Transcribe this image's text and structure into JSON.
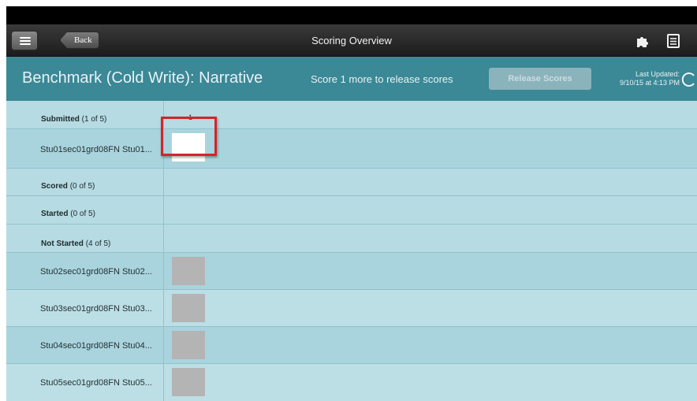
{
  "nav": {
    "back_label": "Back",
    "title": "Scoring Overview",
    "icons": [
      "menu-icon",
      "puzzle-piece-icon",
      "list-icon"
    ]
  },
  "header": {
    "title": "Benchmark (Cold Write): Narrative",
    "score_status": "Score  1  more to release scores",
    "release_button": "Release Scores",
    "last_updated_label": "Last Updated:",
    "last_updated_value": "9/10/15 at 4:13 PM",
    "refresh_icon": "refresh-icon"
  },
  "table": {
    "columns": [
      "1"
    ],
    "sections": [
      {
        "name": "Submitted",
        "count": "(1 of 5)",
        "students": [
          {
            "name": "Stu01sec01grd08FN Stu01...",
            "box": "white",
            "selected": true
          }
        ]
      },
      {
        "name": "Scored",
        "count": "(0 of 5)",
        "students": []
      },
      {
        "name": "Started",
        "count": "(0 of 5)",
        "students": []
      },
      {
        "name": "Not Started",
        "count": "(4 of 5)",
        "students": [
          {
            "name": "Stu02sec01grd08FN Stu02...",
            "box": "gray"
          },
          {
            "name": "Stu03sec01grd08FN Stu03...",
            "box": "gray"
          },
          {
            "name": "Stu04sec01grd08FN Stu04...",
            "box": "gray"
          },
          {
            "name": "Stu05sec01grd08FN Stu05...",
            "box": "gray"
          }
        ]
      }
    ]
  },
  "colors": {
    "header": "#3b8896",
    "table_bg": "#b7dbe3",
    "highlight": "#d4242a",
    "release_disabled": "#8bb3bb"
  }
}
